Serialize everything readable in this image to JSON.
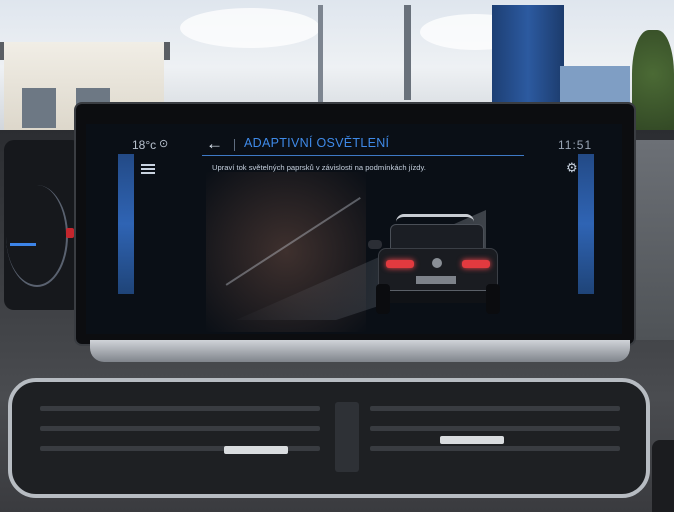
{
  "status_bar": {
    "temperature": "18°c",
    "location_icon": "location-pin-icon",
    "time": "11:51"
  },
  "header": {
    "back_icon": "arrow-left-icon",
    "title": "ADAPTIVNÍ OSVĚTLENÍ"
  },
  "content": {
    "description": "Upraví tok světelných paprsků v závislosti na podmínkách jízdy.",
    "menu_icon": "menu-icon",
    "settings_icon": "wrench-icon"
  },
  "colors": {
    "accent": "#3f8ae8",
    "side_bars": "#2f64b4",
    "tail_lights": "#e23a3f"
  }
}
